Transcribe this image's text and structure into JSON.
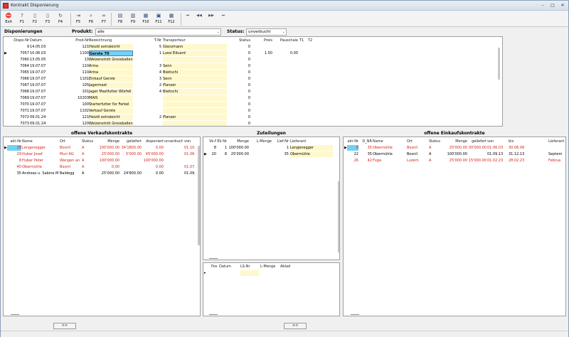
{
  "window": {
    "title": "Kontrakt Disponierung",
    "min": "–",
    "max": "□",
    "close": "✕"
  },
  "toolbar": [
    {
      "label": "Exit",
      "icon": "exit-icon",
      "glyph": "⛔"
    },
    {
      "label": "F1",
      "icon": "help-icon",
      "glyph": "?"
    },
    {
      "label": "F2",
      "icon": "new-document-icon",
      "glyph": "▯"
    },
    {
      "label": "F3",
      "icon": "document-icon",
      "glyph": "▯"
    },
    {
      "label": "F4",
      "icon": "refresh-icon",
      "glyph": "↻"
    },
    {
      "label": "F5",
      "icon": "export-icon",
      "glyph": "⇥"
    },
    {
      "label": "F6",
      "icon": "search-icon",
      "glyph": "⌕"
    },
    {
      "label": "F7",
      "icon": "binoculars-icon",
      "glyph": "∞"
    },
    {
      "label": "F8",
      "icon": "print-icon",
      "glyph": "▤"
    },
    {
      "label": "F9",
      "icon": "print-preview-icon",
      "glyph": "▥"
    },
    {
      "label": "F10",
      "icon": "calendar-icon",
      "glyph": "▦"
    },
    {
      "label": "F11",
      "icon": "save-icon",
      "glyph": "▣"
    },
    {
      "label": "F12",
      "icon": "grid-icon",
      "glyph": "▦"
    }
  ],
  "nav": [
    {
      "icon": "first-record-icon",
      "glyph": "⏮"
    },
    {
      "icon": "previous-record-icon",
      "glyph": "◀◀"
    },
    {
      "icon": "next-record-icon",
      "glyph": "▶▶"
    },
    {
      "icon": "last-record-icon",
      "glyph": "⏭"
    }
  ],
  "filter": {
    "dispo_label": "Disponierungen",
    "produkt_label": "Produkt:",
    "produkt_value": "alle",
    "status_label": "Status:",
    "status_value": "unverbucht"
  },
  "dispo": {
    "headers": [
      "Dispo-Nr",
      "Datum",
      "Prod-Nr",
      "Bezeichnung",
      "T-Nr",
      "Transporteur",
      "Status",
      "Preis",
      "Pauschale",
      "T1",
      "T2"
    ],
    "rows": [
      {
        "nr": "9",
        "datum": "14.05.03",
        "prod": "121",
        "bez": "Heizöl extraleicht",
        "tnr": "5",
        "trans": "Glanzmann",
        "status": "0",
        "preis": "",
        "pausch": "",
        "cur": false
      },
      {
        "nr": "7057",
        "datum": "10.06.03",
        "prod": "1100",
        "bez": "Gerste 70",
        "tnr": "1",
        "trans": "Lussi Eduard",
        "status": "0",
        "preis": "1.50",
        "pausch": "0.00",
        "cur": true
      },
      {
        "nr": "7060",
        "datum": "13.05.05",
        "prod": "13",
        "bez": "Weizenstroh Grossballen",
        "tnr": "",
        "trans": "",
        "status": "0",
        "preis": "",
        "pausch": "",
        "cur": false
      },
      {
        "nr": "7064",
        "datum": "19.07.07",
        "prod": "110",
        "bez": "Arina",
        "tnr": "3",
        "trans": "Senn",
        "status": "0",
        "preis": "",
        "pausch": "",
        "cur": false
      },
      {
        "nr": "7065",
        "datum": "19.07.07",
        "prod": "110",
        "bez": "Arina",
        "tnr": "4",
        "trans": "Bieitschi",
        "status": "0",
        "preis": "",
        "pausch": "",
        "cur": false
      },
      {
        "nr": "7066",
        "datum": "19.07.07",
        "prod": "1101",
        "bez": "Einkauf Gerste",
        "tnr": "3",
        "trans": "Senn",
        "status": "0",
        "preis": "",
        "pausch": "",
        "cur": false
      },
      {
        "nr": "7067",
        "datum": "19.07.07",
        "prod": "105",
        "bez": "Jagermast",
        "tnr": "2",
        "trans": "Planzer",
        "status": "0",
        "preis": "",
        "pausch": "",
        "cur": false
      },
      {
        "nr": "7068",
        "datum": "19.07.07",
        "prod": "101",
        "bez": "Jager Mastfutter Würfeli",
        "tnr": "4",
        "trans": "Bieitschi",
        "status": "0",
        "preis": "",
        "pausch": "",
        "cur": false
      },
      {
        "nr": "7069",
        "datum": "19.07.07",
        "prod": "10203",
        "bez": "MAIS",
        "tnr": "",
        "trans": "",
        "status": "0",
        "preis": "",
        "pausch": "",
        "cur": false
      },
      {
        "nr": "7070",
        "datum": "19.07.07",
        "prod": "100",
        "bez": "Starterfutter für Ferkel",
        "tnr": "",
        "trans": "",
        "status": "0",
        "preis": "",
        "pausch": "",
        "cur": false
      },
      {
        "nr": "7071",
        "datum": "19.07.07",
        "prod": "1102",
        "bez": "Verkauf Gerste",
        "tnr": "",
        "trans": "",
        "status": "0",
        "preis": "",
        "pausch": "",
        "cur": false
      },
      {
        "nr": "7072",
        "datum": "09.01.24",
        "prod": "121",
        "bez": "Heizöl extraleicht",
        "tnr": "2",
        "trans": "Planzer",
        "status": "0",
        "preis": "",
        "pausch": "",
        "cur": false
      },
      {
        "nr": "7073",
        "datum": "09.01.24",
        "prod": "120",
        "bez": "Weizenstroh Grossballen",
        "tnr": "",
        "trans": "",
        "status": "0",
        "preis": "",
        "pausch": "",
        "cur": false
      }
    ]
  },
  "vk": {
    "title": "offene Verkaufskontrakte",
    "headers": [
      "akt-Nr",
      "Name",
      "Ort",
      "Status",
      "Menge",
      "geliefert",
      "disponiert",
      "unverbucht",
      "von"
    ],
    "rows": [
      {
        "nr": "28",
        "name": "Lengenegger",
        "ort": "Bosnil",
        "status": "A",
        "menge": "100'000.00",
        "gel": "34'1800.00",
        "disp": "0.00",
        "unv": "",
        "von": "01.10.",
        "red": true,
        "cur": true
      },
      {
        "nr": "29",
        "name": "Huber Josef",
        "ort": "Muri AG",
        "status": "A",
        "menge": "25'000.00",
        "gel": "5'000.00",
        "disp": "45'000.00",
        "unv": "",
        "von": "01.06.",
        "red": true,
        "cur": false
      },
      {
        "nr": "8",
        "name": "Huber Peter",
        "ort": "Wangen an",
        "status": "A",
        "menge": "100'000.00",
        "gel": "",
        "disp": "100'000.00",
        "unv": "",
        "von": "",
        "red": true,
        "cur": false
      },
      {
        "nr": "40",
        "name": "Obermühle",
        "ort": "Bosnil",
        "status": "A",
        "menge": "0.00",
        "gel": "",
        "disp": "0.00",
        "unv": "",
        "von": "01.07.",
        "red": true,
        "cur": false
      },
      {
        "nr": "35",
        "name": "Andreas u. Sabine M",
        "ort": "Baldegg",
        "status": "A",
        "menge": "25'000.00",
        "gel": "24'800.00",
        "disp": "0.00",
        "unv": "",
        "von": "01.09.",
        "red": false,
        "cur": false
      }
    ]
  },
  "zu": {
    "title": "Zuteilungen",
    "headers": [
      "Vk-Nr",
      "Ek-Nr",
      "Menge",
      "L-Menge",
      "Lief-Nr",
      "Lieferant"
    ],
    "rows": [
      {
        "vk": "8",
        "ek": "1",
        "menge": "100'000.00",
        "lm": "",
        "lnr": "1",
        "lief": "Lengenegger",
        "cur": false
      },
      {
        "vk": "20",
        "ek": "8",
        "menge": "25'000.00",
        "lm": "",
        "lnr": "35",
        "lief": "Obermühle",
        "cur": true
      }
    ],
    "sub_headers": [
      "Pos",
      "Datum",
      "LS-Nr",
      "L-Menge",
      "Ablad"
    ]
  },
  "ek": {
    "title": "offene Einkaufskontrakte",
    "headers": [
      "akt-Nr",
      "D_NR",
      "Name",
      "Ort",
      "Status",
      "Menge",
      "geliefert",
      "von",
      "bis",
      "Lieferant"
    ],
    "rows": [
      {
        "nr": "8",
        "dnr": "35",
        "name": "Obermühle",
        "ort": "Bosnil",
        "status": "A",
        "menge": "25'000.00",
        "gel": "30'000.00",
        "von": "01.06.03",
        "bis": "30.06.06",
        "lief": "",
        "red": true,
        "cur": true
      },
      {
        "nr": "22",
        "dnr": "35",
        "name": "Obermühle",
        "ort": "Bosnil",
        "status": "A",
        "menge": "100'000.00",
        "gel": "",
        "von": "01.09.13",
        "bis": "31.12.13",
        "lief": "Septem",
        "red": false,
        "cur": false
      },
      {
        "nr": "26",
        "dnr": "42",
        "name": "Fuga",
        "ort": "Luzern",
        "status": "A",
        "menge": "25'000.00",
        "gel": "15'000.00",
        "von": "01.02.23",
        "bis": "28.02.23",
        "lief": "Februa",
        "red": true,
        "cur": false
      }
    ]
  },
  "buttons": {
    "forward": ">>",
    "back": "<<"
  }
}
